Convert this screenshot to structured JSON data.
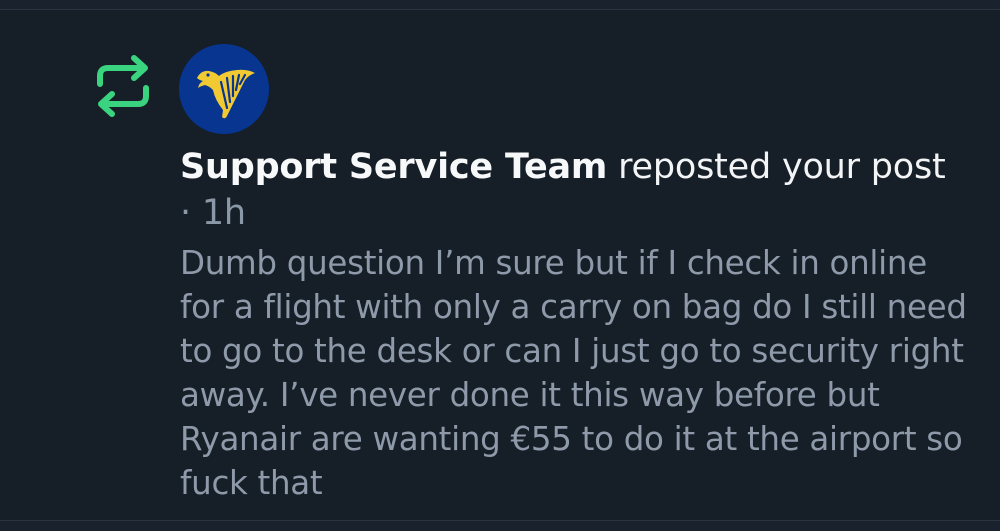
{
  "notification": {
    "icon": "repost-icon",
    "accent_color": "#3ad37f",
    "avatar": {
      "icon": "ryanair-harp-logo",
      "background_color": "#073590",
      "logo_color": "#f1c933"
    },
    "actor_name": "Support Service Team",
    "action_text": " reposted your post",
    "timestamp": "· 1h",
    "post_text": "Dumb question I’m sure but if I check in online for a flight with only a carry on bag do I still need to go to the desk or can I just go to security right away. I’ve never done it this way before but Ryanair are wanting €55 to do it at the airport so fuck that"
  }
}
